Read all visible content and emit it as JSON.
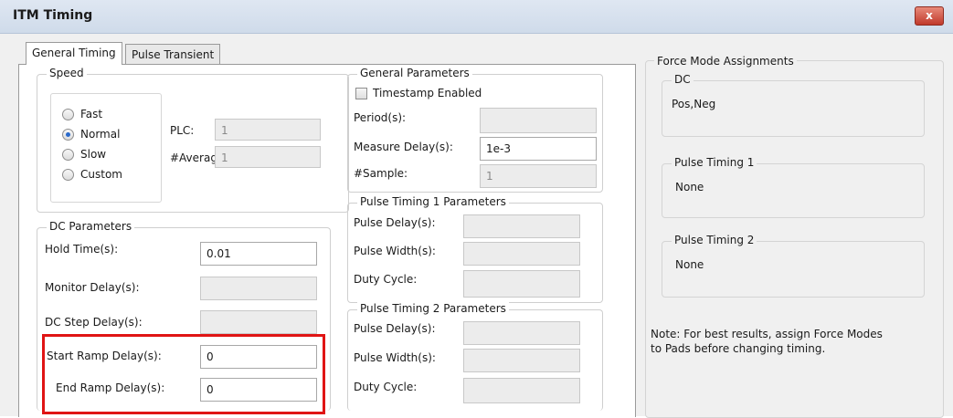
{
  "window": {
    "title": "ITM Timing",
    "close_label": "x"
  },
  "tabs": [
    {
      "label": "General Timing",
      "active": true
    },
    {
      "label": "Pulse Transient",
      "active": false
    }
  ],
  "speed": {
    "title": "Speed",
    "options": [
      {
        "label": "Fast",
        "checked": false
      },
      {
        "label": "Normal",
        "checked": true
      },
      {
        "label": "Slow",
        "checked": false
      },
      {
        "label": "Custom",
        "checked": false
      }
    ],
    "plc_label": "PLC:",
    "plc_value": "1",
    "average_label": "#Average:",
    "average_value": "1"
  },
  "dc_parameters": {
    "title": "DC Parameters",
    "hold_time_label": "Hold Time(s):",
    "hold_time_value": "0.01",
    "monitor_delay_label": "Monitor Delay(s):",
    "monitor_delay_value": "",
    "dc_step_delay_label": "DC Step Delay(s):",
    "dc_step_delay_value": "",
    "start_ramp_label": "Start Ramp Delay(s):",
    "start_ramp_value": "0",
    "end_ramp_label": "End Ramp Delay(s):",
    "end_ramp_value": "0"
  },
  "general_parameters": {
    "title": "General Parameters",
    "timestamp_label": "Timestamp Enabled",
    "timestamp_checked": false,
    "period_label": "Period(s):",
    "period_value": "",
    "measure_delay_label": "Measure Delay(s):",
    "measure_delay_value": "1e-3",
    "sample_label": "#Sample:",
    "sample_value": "1"
  },
  "pulse1": {
    "title": "Pulse Timing 1 Parameters",
    "delay_label": "Pulse Delay(s):",
    "width_label": "Pulse Width(s):",
    "duty_label": "Duty Cycle:"
  },
  "pulse2": {
    "title": "Pulse Timing 2 Parameters",
    "delay_label": "Pulse Delay(s):",
    "width_label": "Pulse Width(s):",
    "duty_label": "Duty Cycle:"
  },
  "force_mode": {
    "title": "Force Mode Assignments",
    "dc_title": "DC",
    "dc_value": "Pos,Neg",
    "pt1_title": "Pulse Timing 1",
    "pt1_value": "None",
    "pt2_title": "Pulse Timing 2",
    "pt2_value": "None",
    "note_line1": "Note: For best results, assign Force Modes",
    "note_line2": "to Pads before changing timing."
  },
  "colors": {
    "highlight": "#e01414",
    "close_button": "#c0392b",
    "radio_dot": "#2a6acb"
  }
}
